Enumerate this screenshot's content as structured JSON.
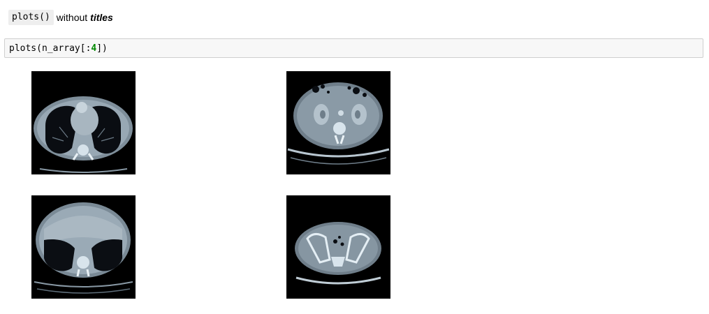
{
  "markdown": {
    "code": "plots()",
    "text": "without",
    "emphasis": "titles"
  },
  "code_cell": {
    "prefix": "plots(n_array[:",
    "number": "4",
    "suffix": "])"
  },
  "output": {
    "images": [
      {
        "subject": "axial CT slice - chest (lungs and heart)"
      },
      {
        "subject": "axial CT slice - upper abdomen (kidneys)"
      },
      {
        "subject": "axial CT slice - lower chest (lung bases)"
      },
      {
        "subject": "axial CT slice - pelvis"
      }
    ],
    "colormap": "bone"
  }
}
